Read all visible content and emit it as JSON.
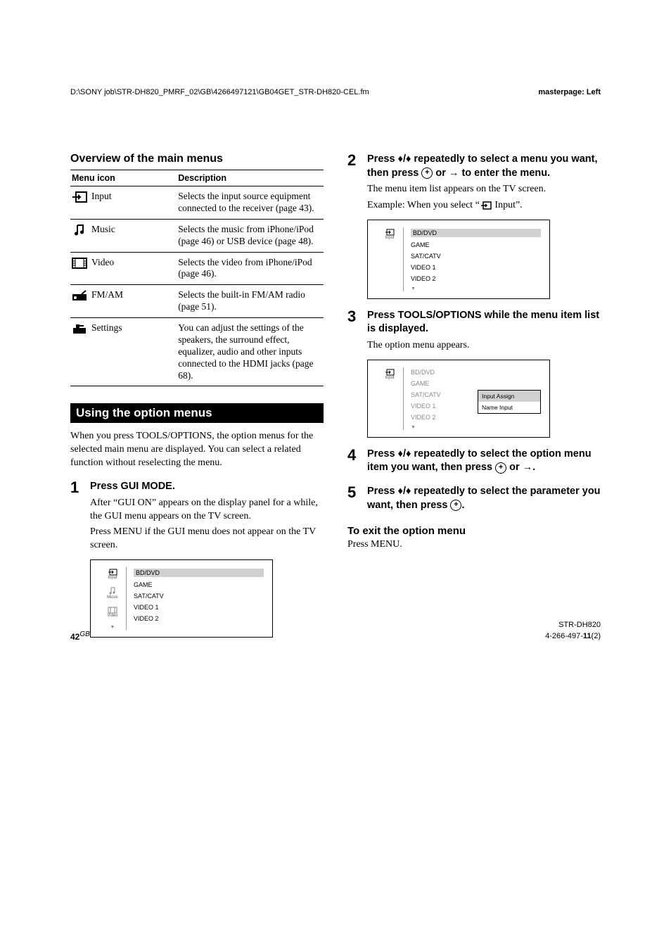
{
  "header": {
    "path": "D:\\SONY job\\STR-DH820_PMRF_02\\GB\\4266497121\\GB04GET_STR-DH820-CEL.fm",
    "master": "masterpage: Left"
  },
  "left": {
    "overview_title": "Overview of the main menus",
    "table": {
      "col1": "Menu icon",
      "col2": "Description",
      "rows": [
        {
          "name": "Input",
          "desc": "Selects the input source equipment connected to the receiver (page 43)."
        },
        {
          "name": "Music",
          "desc": "Selects the music from iPhone/iPod (page 46) or USB device (page 48)."
        },
        {
          "name": "Video",
          "desc": "Selects the video from iPhone/iPod (page 46)."
        },
        {
          "name": "FM/AM",
          "desc": "Selects the built-in FM/AM radio (page 51)."
        },
        {
          "name": "Settings",
          "desc": "You can adjust the settings of the speakers, the surround effect, equalizer, audio and other inputs connected to the HDMI jacks (page 68)."
        }
      ]
    },
    "option_menus_title": "Using the option menus",
    "option_menus_intro": "When you press TOOLS/OPTIONS, the option menus for the selected main menu are displayed. You can select a related function without reselecting the menu.",
    "step1": {
      "num": "1",
      "head": "Press GUI MODE.",
      "body1": "After “GUI ON” appears on the display panel for a while, the GUI menu appears on the TV screen.",
      "body2": "Press MENU if the GUI menu does not appear on the TV screen."
    },
    "screenshot1": {
      "side": [
        "Input",
        "Music",
        "Video"
      ],
      "list": [
        "BD/DVD",
        "GAME",
        "SAT/CATV",
        "VIDEO 1",
        "VIDEO 2"
      ]
    }
  },
  "right": {
    "step2": {
      "num": "2",
      "head_a": "Press ",
      "head_b": " repeatedly to select a menu you want, then press ",
      "head_c": " or ",
      "head_d": " to enter the menu.",
      "body1": "The menu item list appears on the TV screen.",
      "body2a": "Example: When you select “",
      "body2b": " Input”."
    },
    "screenshot2": {
      "side": [
        "Input"
      ],
      "list": [
        "BD/DVD",
        "GAME",
        "SAT/CATV",
        "VIDEO 1",
        "VIDEO 2"
      ]
    },
    "step3": {
      "num": "3",
      "head": "Press TOOLS/OPTIONS while the menu item list is displayed.",
      "body": "The option menu appears."
    },
    "screenshot3": {
      "side": [
        "Input"
      ],
      "list": [
        "BD/DVD",
        "GAME",
        "SAT/CATV",
        "VIDEO 1",
        "VIDEO 2"
      ],
      "opts": [
        "Input Assign",
        "Name Input"
      ]
    },
    "step4": {
      "num": "4",
      "head_a": "Press ",
      "head_b": " repeatedly to select the option menu item you want, then press ",
      "head_c": " or ",
      "head_d": "."
    },
    "step5": {
      "num": "5",
      "head_a": "Press ",
      "head_b": " repeatedly to select the parameter you want, then press ",
      "head_c": "."
    },
    "exit_title": "To exit the option menu",
    "exit_body": "Press MENU."
  },
  "footer": {
    "page": "42",
    "gb": "GB",
    "model": "STR-DH820",
    "code_a": "4-266-497-",
    "code_b": "11",
    "code_c": "(2)"
  }
}
